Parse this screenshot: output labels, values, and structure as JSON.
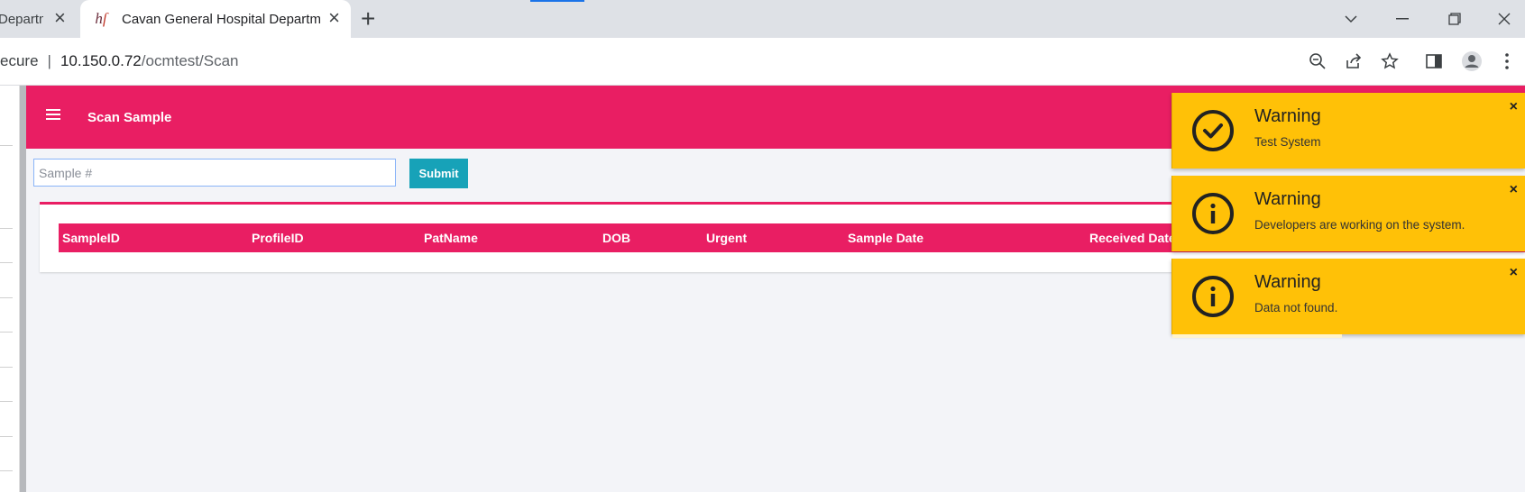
{
  "browser": {
    "tabs": [
      {
        "title": "Departm",
        "active": false
      },
      {
        "title": "Cavan General Hospital Departm",
        "active": true
      }
    ],
    "favicon_text": "hſe",
    "url": {
      "security": "ecure",
      "host": "10.150.0.72",
      "path": "/ocmtest/Scan"
    }
  },
  "app": {
    "title": "Scan Sample",
    "search": {
      "placeholder": "Sample #",
      "value": ""
    },
    "submit_label": "Submit",
    "accent_color": "#e91e63",
    "button_color": "#17a2b8"
  },
  "table": {
    "columns": [
      "SampleID",
      "ProfileID",
      "PatName",
      "DOB",
      "Urgent",
      "Sample Date",
      "Received Date"
    ],
    "rows": []
  },
  "toasts": [
    {
      "title": "Warning",
      "message": "Test System",
      "icon": "check-circle-icon"
    },
    {
      "title": "Warning",
      "message": "Developers are working on the system.",
      "icon": "info-circle-icon"
    },
    {
      "title": "Warning",
      "message": "Data not found.",
      "icon": "info-circle-icon",
      "progress": 0.48
    }
  ],
  "toast_color": "#ffc107"
}
